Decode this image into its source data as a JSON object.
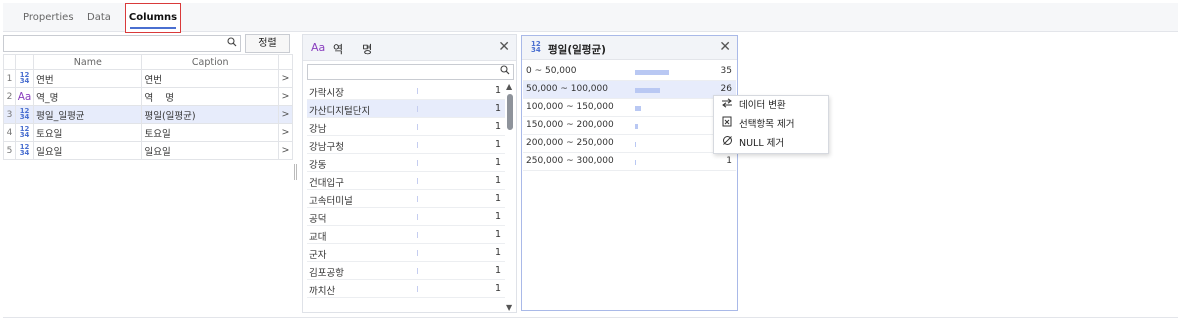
{
  "tabs": [
    "Properties",
    "Data",
    "Columns"
  ],
  "left_panel": {
    "search_placeholder": "",
    "sort_button": "정렬",
    "headers": {
      "name": "Name",
      "caption": "Caption"
    },
    "rows": [
      {
        "num": "1",
        "type": "number",
        "name": "연번",
        "caption": "연번"
      },
      {
        "num": "2",
        "type": "text",
        "name": "역_명",
        "caption": "역    명"
      },
      {
        "num": "3",
        "type": "number",
        "name": "평일_일평균",
        "caption": "평일(일평균)"
      },
      {
        "num": "4",
        "type": "number",
        "name": "토요일",
        "caption": "토요일"
      },
      {
        "num": "5",
        "type": "number",
        "name": "일요일",
        "caption": "일요일"
      }
    ],
    "arrow": ">",
    "type_icons": {
      "text": "Aa",
      "number_top": "12",
      "number_bottom": "34"
    }
  },
  "station_panel": {
    "type_icon": "Aa",
    "title": "역  명",
    "close": "✕",
    "items": [
      {
        "label": "가락시장",
        "count": "1"
      },
      {
        "label": "가산디지털단지",
        "count": "1"
      },
      {
        "label": "강남",
        "count": "1"
      },
      {
        "label": "강남구청",
        "count": "1"
      },
      {
        "label": "강동",
        "count": "1"
      },
      {
        "label": "건대입구",
        "count": "1"
      },
      {
        "label": "고속터미널",
        "count": "1"
      },
      {
        "label": "공덕",
        "count": "1"
      },
      {
        "label": "교대",
        "count": "1"
      },
      {
        "label": "군자",
        "count": "1"
      },
      {
        "label": "김포공항",
        "count": "1"
      },
      {
        "label": "까치산",
        "count": "1"
      }
    ]
  },
  "histogram_panel": {
    "title": "평일(일평균)",
    "close": "✕",
    "bins": [
      {
        "label": "0 ~ 50,000",
        "count": "35",
        "fraction": 1.0
      },
      {
        "label": "50,000 ~ 100,000",
        "count": "26",
        "fraction": 0.74
      },
      {
        "label": "100,000 ~ 150,000",
        "count": "",
        "fraction": 0.17
      },
      {
        "label": "150,000 ~ 200,000",
        "count": "",
        "fraction": 0.09
      },
      {
        "label": "200,000 ~ 250,000",
        "count": "",
        "fraction": 0.03
      },
      {
        "label": "250,000 ~ 300,000",
        "count": "1",
        "fraction": 0.03
      }
    ]
  },
  "context_menu": [
    {
      "icon": "swap-icon",
      "label": "데이터 변환"
    },
    {
      "icon": "remove-selection-icon",
      "label": "선택항목 제거"
    },
    {
      "icon": "null-icon",
      "label": "NULL 제거"
    }
  ]
}
